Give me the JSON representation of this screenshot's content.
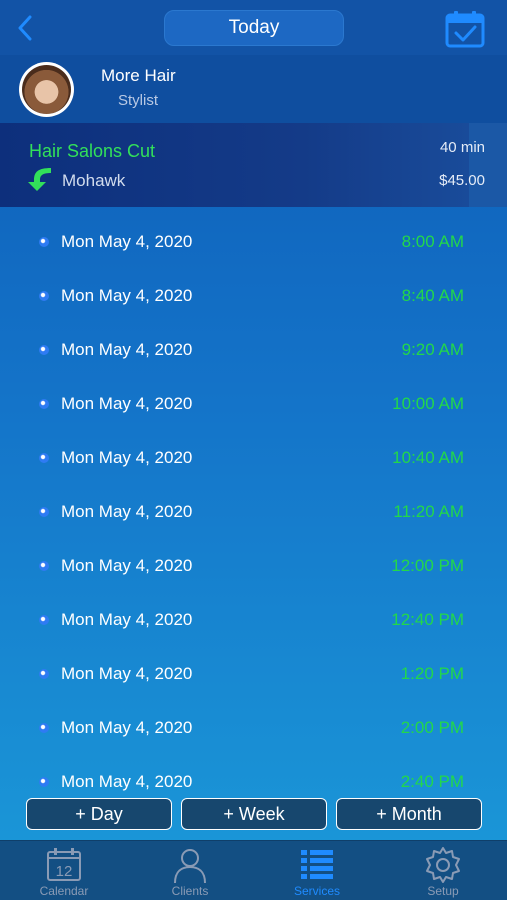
{
  "header": {
    "today_label": "Today",
    "colors": {
      "bar": "#1253a6",
      "accent": "#1f8bff"
    }
  },
  "stylist": {
    "name": "More Hair",
    "role": "Stylist"
  },
  "service": {
    "name": "Hair Salons Cut",
    "style": "Mohawk",
    "duration": "40 min",
    "price": "$45.00"
  },
  "slots": [
    {
      "date": "Mon May 4, 2020",
      "time": "8:00 AM"
    },
    {
      "date": "Mon May 4, 2020",
      "time": "8:40 AM"
    },
    {
      "date": "Mon May 4, 2020",
      "time": "9:20 AM"
    },
    {
      "date": "Mon May 4, 2020",
      "time": "10:00 AM"
    },
    {
      "date": "Mon May 4, 2020",
      "time": "10:40 AM"
    },
    {
      "date": "Mon May 4, 2020",
      "time": "11:20 AM"
    },
    {
      "date": "Mon May 4, 2020",
      "time": "12:00 PM"
    },
    {
      "date": "Mon May 4, 2020",
      "time": "12:40 PM"
    },
    {
      "date": "Mon May 4, 2020",
      "time": "1:20 PM"
    },
    {
      "date": "Mon May 4, 2020",
      "time": "2:00 PM"
    },
    {
      "date": "Mon May 4, 2020",
      "time": "2:40 PM"
    }
  ],
  "range_buttons": {
    "day": "+ Day",
    "week": "+ Week",
    "month": "+ Month"
  },
  "tabs": [
    {
      "label": "Calendar",
      "icon": "calendar-icon",
      "calendar_day": "12",
      "active": false
    },
    {
      "label": "Clients",
      "icon": "person-icon",
      "active": false
    },
    {
      "label": "Services",
      "icon": "list-icon",
      "active": true
    },
    {
      "label": "Setup",
      "icon": "gear-icon",
      "active": false
    }
  ]
}
